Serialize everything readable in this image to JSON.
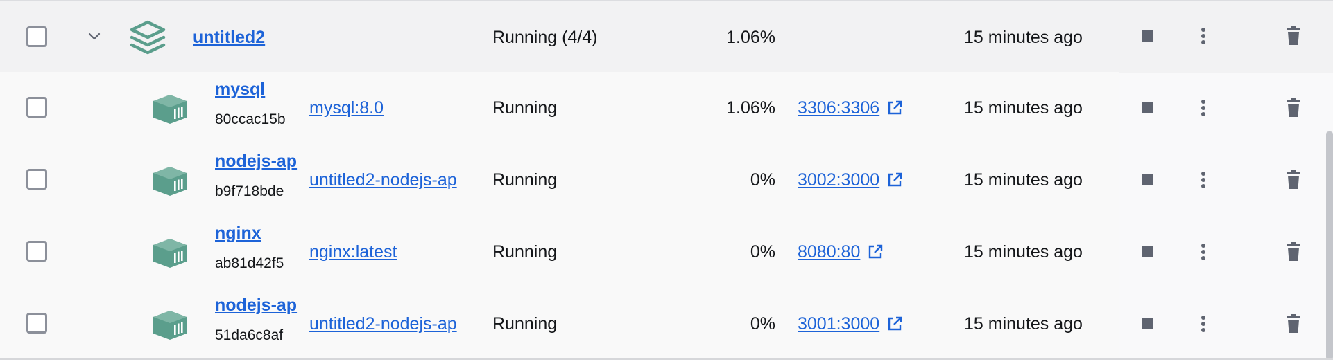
{
  "group": {
    "name": "untitled2",
    "status": "Running (4/4)",
    "cpu": "1.06%",
    "last_started": "15 minutes ago"
  },
  "containers": [
    {
      "name": "mysql",
      "id": "80ccac15b",
      "image": "mysql:8.0",
      "status": "Running",
      "cpu": "1.06%",
      "port": "3306:3306",
      "last_started": "15 minutes ago"
    },
    {
      "name": "nodejs-ap",
      "id": "b9f718bde",
      "image": "untitled2-nodejs-ap",
      "status": "Running",
      "cpu": "0%",
      "port": "3002:3000",
      "last_started": "15 minutes ago"
    },
    {
      "name": "nginx",
      "id": "ab81d42f5",
      "image": "nginx:latest",
      "status": "Running",
      "cpu": "0%",
      "port": "8080:80",
      "last_started": "15 minutes ago"
    },
    {
      "name": "nodejs-ap",
      "id": "51da6c8af",
      "image": "untitled2-nodejs-ap",
      "status": "Running",
      "cpu": "0%",
      "port": "3001:3000",
      "last_started": "15 minutes ago"
    }
  ],
  "icons": {
    "expand": "chevron-down-icon",
    "group": "stack-layers-icon",
    "container": "container-cube-icon",
    "port_link": "external-link-icon",
    "stop": "stop-icon",
    "more": "more-vertical-icon",
    "delete": "trash-icon"
  },
  "colors": {
    "accent_link": "#1d63d8",
    "icon_teal": "#5b9e8c",
    "action_gray": "#5f6470",
    "group_row_bg": "#f2f2f3"
  }
}
